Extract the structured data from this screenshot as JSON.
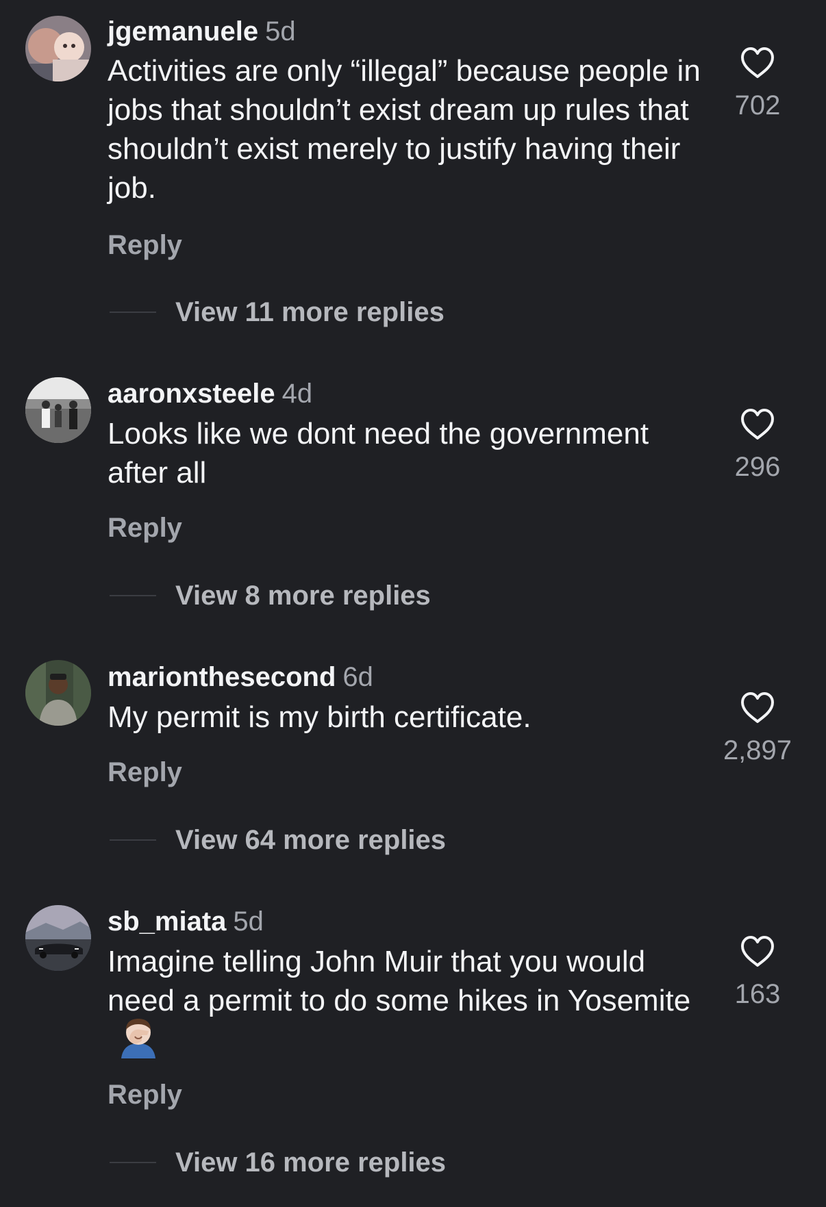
{
  "comments": [
    {
      "username": "jgemanuele",
      "time": "5d",
      "text": "Activities are only “illegal” because people in jobs that shouldn’t exist dream up rules that shouldn’t exist merely to justify having their job.",
      "reply_label": "Reply",
      "likes": "702",
      "view_more": "View 11 more replies",
      "avatar": "baby-photo-avatar"
    },
    {
      "username": "aaronxsteele",
      "time": "4d",
      "text": "Looks like we dont need the government after all",
      "reply_label": "Reply",
      "likes": "296",
      "view_more": "View 8 more replies",
      "avatar": "wedding-photo-avatar"
    },
    {
      "username": "marionthesecond",
      "time": "6d",
      "text": "My permit is my birth certificate.",
      "reply_label": "Reply",
      "likes": "2,897",
      "view_more": "View 64 more replies",
      "avatar": "person-photo-avatar"
    },
    {
      "username": "sb_miata",
      "time": "5d",
      "text": "Imagine telling John Muir that you would need a permit to do some hikes in Yosemite",
      "emoji": "face-palm-emoji",
      "reply_label": "Reply",
      "likes": "163",
      "view_more": "View 16 more replies",
      "avatar": "car-photo-avatar"
    }
  ],
  "colors": {
    "background": "#1f2024",
    "primary_text": "#f3f4f6",
    "secondary_text": "#a3a6ad"
  }
}
